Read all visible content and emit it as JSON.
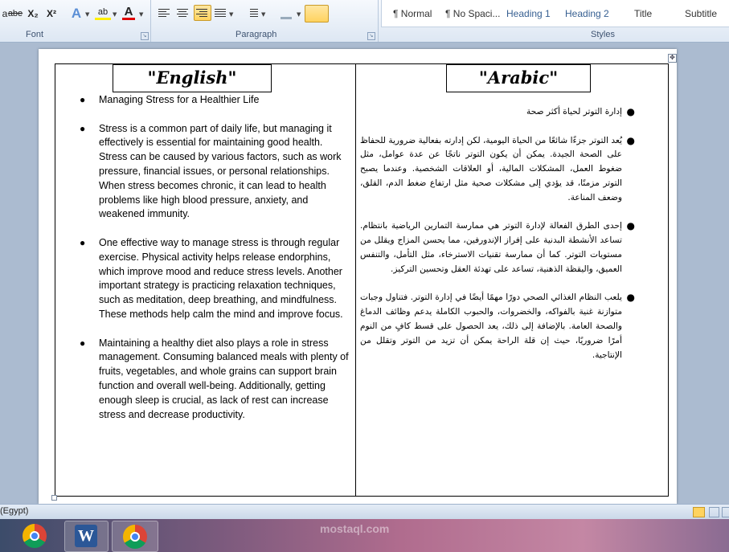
{
  "ribbon": {
    "font_group_label": "Font",
    "paragraph_group_label": "Paragraph",
    "styles_group_label": "Styles",
    "font_buttons": {
      "strikethrough": "abe",
      "subscript": "X₂",
      "superscript": "X²",
      "text_effects": "A",
      "highlight": "ab",
      "font_color": "A"
    },
    "styles": [
      "¶ Normal",
      "¶ No Spaci...",
      "Heading 1",
      "Heading 2",
      "Title",
      "Subtitle"
    ]
  },
  "document": {
    "english_header": "\"English\"",
    "arabic_header": "\"Arabic\"",
    "english_items": [
      "Managing Stress for a Healthier Life",
      "Stress is a common part of daily life, but managing it effectively is essential for maintaining good health. Stress can be caused by various factors, such as work pressure, financial issues, or personal relationships. When stress becomes chronic, it can lead to health problems like high blood pressure, anxiety, and weakened immunity.",
      "One effective way to manage stress is through regular exercise. Physical activity helps release endorphins, which improve mood and reduce stress levels. Another important strategy is practicing relaxation techniques, such as meditation, deep breathing, and mindfulness. These methods help calm the mind and improve focus.",
      "Maintaining a healthy diet also plays a role in stress management. Consuming balanced meals with plenty of fruits, vegetables, and whole grains can support brain function and overall well-being. Additionally, getting enough sleep is crucial, as lack of rest can increase stress and decrease productivity."
    ],
    "arabic_items": [
      "إدارة التوتر لحياة أكثر صحة",
      "يُعد التوتر جزءًا شائعًا من الحياة اليومية، لكن إدارته بفعالية ضرورية للحفاظ على الصحة الجيدة. يمكن أن يكون التوتر ناتجًا عن عدة عوامل، مثل ضغوط العمل، المشكلات المالية، أو العلاقات الشخصية. وعندما يصبح التوتر مزمنًا، قد يؤدي إلى مشكلات صحية مثل ارتفاع ضغط الدم، القلق، وضعف المناعة.",
      "إحدى الطرق الفعالة لإدارة التوتر هي ممارسة التمارين الرياضية بانتظام. تساعد الأنشطة البدنية على إفراز الإندورفين، مما يحسن المزاج ويقلل من مستويات التوتر. كما أن ممارسة تقنيات الاسترخاء، مثل التأمل، والتنفس العميق، واليقظة الذهنية، تساعد على تهدئة العقل وتحسين التركيز.",
      "يلعب النظام الغذائي الصحي دورًا مهمًا أيضًا في إدارة التوتر. فتناول وجبات متوازنة غنية بالفواكه، والخضروات، والحبوب الكاملة يدعم وظائف الدماغ والصحة العامة. بالإضافة إلى ذلك، يعد الحصول على قسط كافٍ من النوم أمرًا ضروريًا، حيث إن قلة الراحة يمكن أن تزيد من التوتر وتقلل من الإنتاجية."
    ]
  },
  "status_bar": {
    "language": "(Egypt)"
  },
  "taskbar": {
    "word_letter": "W"
  },
  "watermark": {
    "text": "mostaql.com"
  },
  "colors": {
    "ribbon_bg": "#dde7f3",
    "workspace_bg": "#abbbd0",
    "heading_style": "#365f91",
    "active_button": "#ffd35f"
  }
}
